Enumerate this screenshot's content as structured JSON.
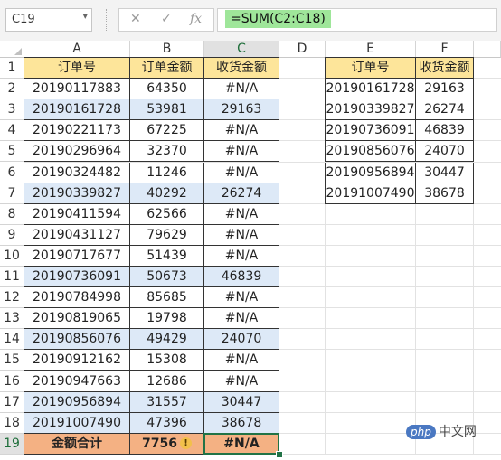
{
  "formula_bar": {
    "name_box": "C19",
    "cancel_icon": "✕",
    "enter_icon": "✓",
    "fx_label": "fx",
    "formula": "=SUM(C2:C18)"
  },
  "columns": [
    "A",
    "B",
    "C",
    "D",
    "E",
    "F"
  ],
  "row_numbers": [
    "1",
    "2",
    "3",
    "4",
    "5",
    "6",
    "7",
    "8",
    "9",
    "10",
    "11",
    "12",
    "13",
    "14",
    "15",
    "16",
    "17",
    "18",
    "19"
  ],
  "table1": {
    "headers": [
      "订单号",
      "订单金额",
      "收货金额"
    ],
    "rows": [
      {
        "a": "20190117883",
        "b": "64350",
        "c": "#N/A",
        "banded": false
      },
      {
        "a": "20190161728",
        "b": "53981",
        "c": "29163",
        "banded": true
      },
      {
        "a": "20190221173",
        "b": "67225",
        "c": "#N/A",
        "banded": false
      },
      {
        "a": "20190296964",
        "b": "32370",
        "c": "#N/A",
        "banded": false
      },
      {
        "a": "20190324482",
        "b": "11246",
        "c": "#N/A",
        "banded": false
      },
      {
        "a": "20190339827",
        "b": "40292",
        "c": "26274",
        "banded": true
      },
      {
        "a": "20190411594",
        "b": "62566",
        "c": "#N/A",
        "banded": false
      },
      {
        "a": "20190431127",
        "b": "79629",
        "c": "#N/A",
        "banded": false
      },
      {
        "a": "20190717677",
        "b": "51439",
        "c": "#N/A",
        "banded": false
      },
      {
        "a": "20190736091",
        "b": "50673",
        "c": "46839",
        "banded": true
      },
      {
        "a": "20190784998",
        "b": "85685",
        "c": "#N/A",
        "banded": false
      },
      {
        "a": "20190819065",
        "b": "19798",
        "c": "#N/A",
        "banded": false
      },
      {
        "a": "20190856076",
        "b": "49429",
        "c": "24070",
        "banded": true
      },
      {
        "a": "20190912162",
        "b": "15308",
        "c": "#N/A",
        "banded": false
      },
      {
        "a": "20190947663",
        "b": "12686",
        "c": "#N/A",
        "banded": false
      },
      {
        "a": "20190956894",
        "b": "31557",
        "c": "30447",
        "banded": true
      },
      {
        "a": "20191007490",
        "b": "47396",
        "c": "38678",
        "banded": true
      }
    ],
    "total_row": {
      "label": "金额合计",
      "sum_b": "7756",
      "warn_icon": "!",
      "sum_c": "#N/A"
    }
  },
  "table2": {
    "headers": [
      "订单号",
      "收货金额"
    ],
    "rows": [
      [
        "20190161728",
        "29163"
      ],
      [
        "20190339827",
        "26274"
      ],
      [
        "20190736091",
        "46839"
      ],
      [
        "20190856076",
        "24070"
      ],
      [
        "20190956894",
        "30447"
      ],
      [
        "20191007490",
        "38678"
      ]
    ]
  },
  "watermark": {
    "logo": "php",
    "text": "中文网"
  },
  "colors": {
    "header_fill": "#fde59a",
    "band_fill": "#dde9f7",
    "total_fill": "#f4b183",
    "selection": "#217346",
    "formula_highlight": "#9fe69a"
  }
}
